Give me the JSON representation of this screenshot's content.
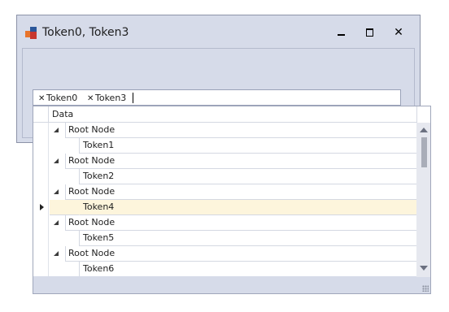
{
  "window": {
    "title": "Token0, Token3"
  },
  "token_editor": {
    "tokens": [
      "Token0",
      "Token3"
    ]
  },
  "grid": {
    "column_header": "Data",
    "rows": [
      {
        "label": "Root Node",
        "level": "root"
      },
      {
        "label": "Token1",
        "level": "child"
      },
      {
        "label": "Root Node",
        "level": "root"
      },
      {
        "label": "Token2",
        "level": "child"
      },
      {
        "label": "Root Node",
        "level": "root"
      },
      {
        "label": "Token4",
        "level": "child",
        "focused": true
      },
      {
        "label": "Root Node",
        "level": "root"
      },
      {
        "label": "Token5",
        "level": "child"
      },
      {
        "label": "Root Node",
        "level": "root"
      },
      {
        "label": "Token6",
        "level": "child"
      }
    ]
  },
  "colors": {
    "window_bg": "#d6dbe9",
    "focused_row": "#fdf5dc"
  }
}
